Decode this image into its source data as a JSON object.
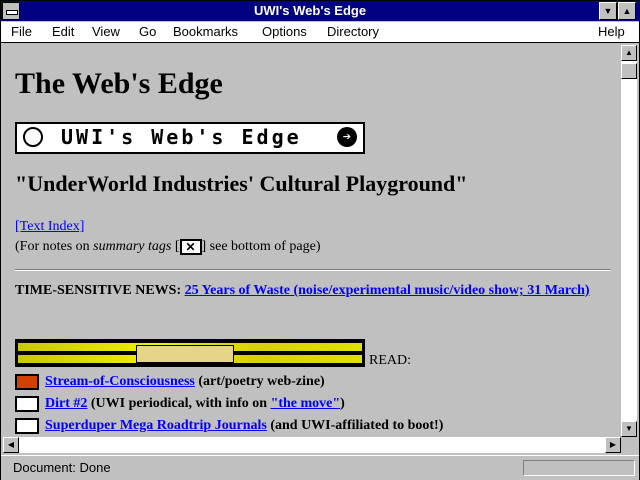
{
  "window": {
    "title": "UWI's Web's Edge"
  },
  "menu": {
    "file": "File",
    "edit": "Edit",
    "view": "View",
    "go": "Go",
    "bookmarks": "Bookmarks",
    "options": "Options",
    "directory": "Directory",
    "help": "Help"
  },
  "page": {
    "heading": "The Web's Edge",
    "logo_text": "UWI's Web's Edge",
    "subheading": "\"UnderWorld Industries' Cultural Playground\"",
    "text_index_link": "[Text Index]",
    "notes_prefix": "(For notes on ",
    "notes_em": "summary tags",
    "notes_bracket_open": " [",
    "notes_suffix": "] see bottom of page)",
    "news_label": "TIME-SENSITIVE NEWS:",
    "news_link": "25 Years of Waste (noise/experimental music/video show; 31 March)",
    "read_label": "READ:",
    "items": [
      {
        "link": "Stream-of-Consciousness",
        "desc": " (art/poetry web-zine)"
      },
      {
        "link": "Dirt #2",
        "desc": " (UWI periodical, with info on ",
        "link2": "\"the move\"",
        "desc2": ")"
      },
      {
        "link": "Superduper Mega Roadtrip Journals",
        "desc": " (and UWI-affiliated to boot!)"
      }
    ]
  },
  "status": {
    "text": "Document: Done"
  },
  "colors": {
    "titlebar": "#000080",
    "link": "#0000ff",
    "background": "#c0c0c0"
  }
}
